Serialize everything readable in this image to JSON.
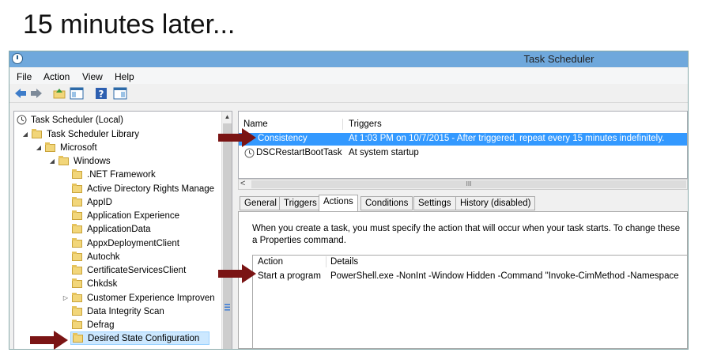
{
  "slide": {
    "caption": "15 minutes later..."
  },
  "window": {
    "title": "Task Scheduler"
  },
  "menu": [
    "File",
    "Action",
    "View",
    "Help"
  ],
  "tree": {
    "items": [
      {
        "label": "Task Scheduler (Local)"
      },
      {
        "label": "Task Scheduler Library"
      },
      {
        "label": "Microsoft"
      },
      {
        "label": "Windows"
      },
      {
        "label": ".NET Framework"
      },
      {
        "label": "Active Directory Rights Manage"
      },
      {
        "label": "AppID"
      },
      {
        "label": "Application Experience"
      },
      {
        "label": "ApplicationData"
      },
      {
        "label": "AppxDeploymentClient"
      },
      {
        "label": "Autochk"
      },
      {
        "label": "CertificateServicesClient"
      },
      {
        "label": "Chkdsk"
      },
      {
        "label": "Customer Experience Improven"
      },
      {
        "label": "Data Integrity Scan"
      },
      {
        "label": "Defrag"
      },
      {
        "label": "Desired State Configuration"
      }
    ]
  },
  "task_list": {
    "headers": {
      "name": "Name",
      "triggers": "Triggers"
    },
    "rows": [
      {
        "name": "Consistency",
        "triggers": "At 1:03 PM on 10/7/2015 - After triggered, repeat every 15 minutes indefinitely."
      },
      {
        "name": "DSCRestartBootTask",
        "triggers": "At system startup"
      }
    ],
    "scroll_thumb": "III"
  },
  "tabs": [
    "General",
    "Triggers",
    "Actions",
    "Conditions",
    "Settings",
    "History (disabled)"
  ],
  "actions_tab": {
    "description": "When you create a task, you must specify the action that will occur when your task starts.  To change these a Properties command.",
    "headers": {
      "action": "Action",
      "details": "Details"
    },
    "rows": [
      {
        "action": "Start a program",
        "details": "PowerShell.exe -NonInt -Window Hidden -Command \"Invoke-CimMethod -Namespace"
      }
    ]
  },
  "colors": {
    "arrow": "#7a1414",
    "selection": "#3399ff",
    "titlebar": "#6fa8dc"
  }
}
